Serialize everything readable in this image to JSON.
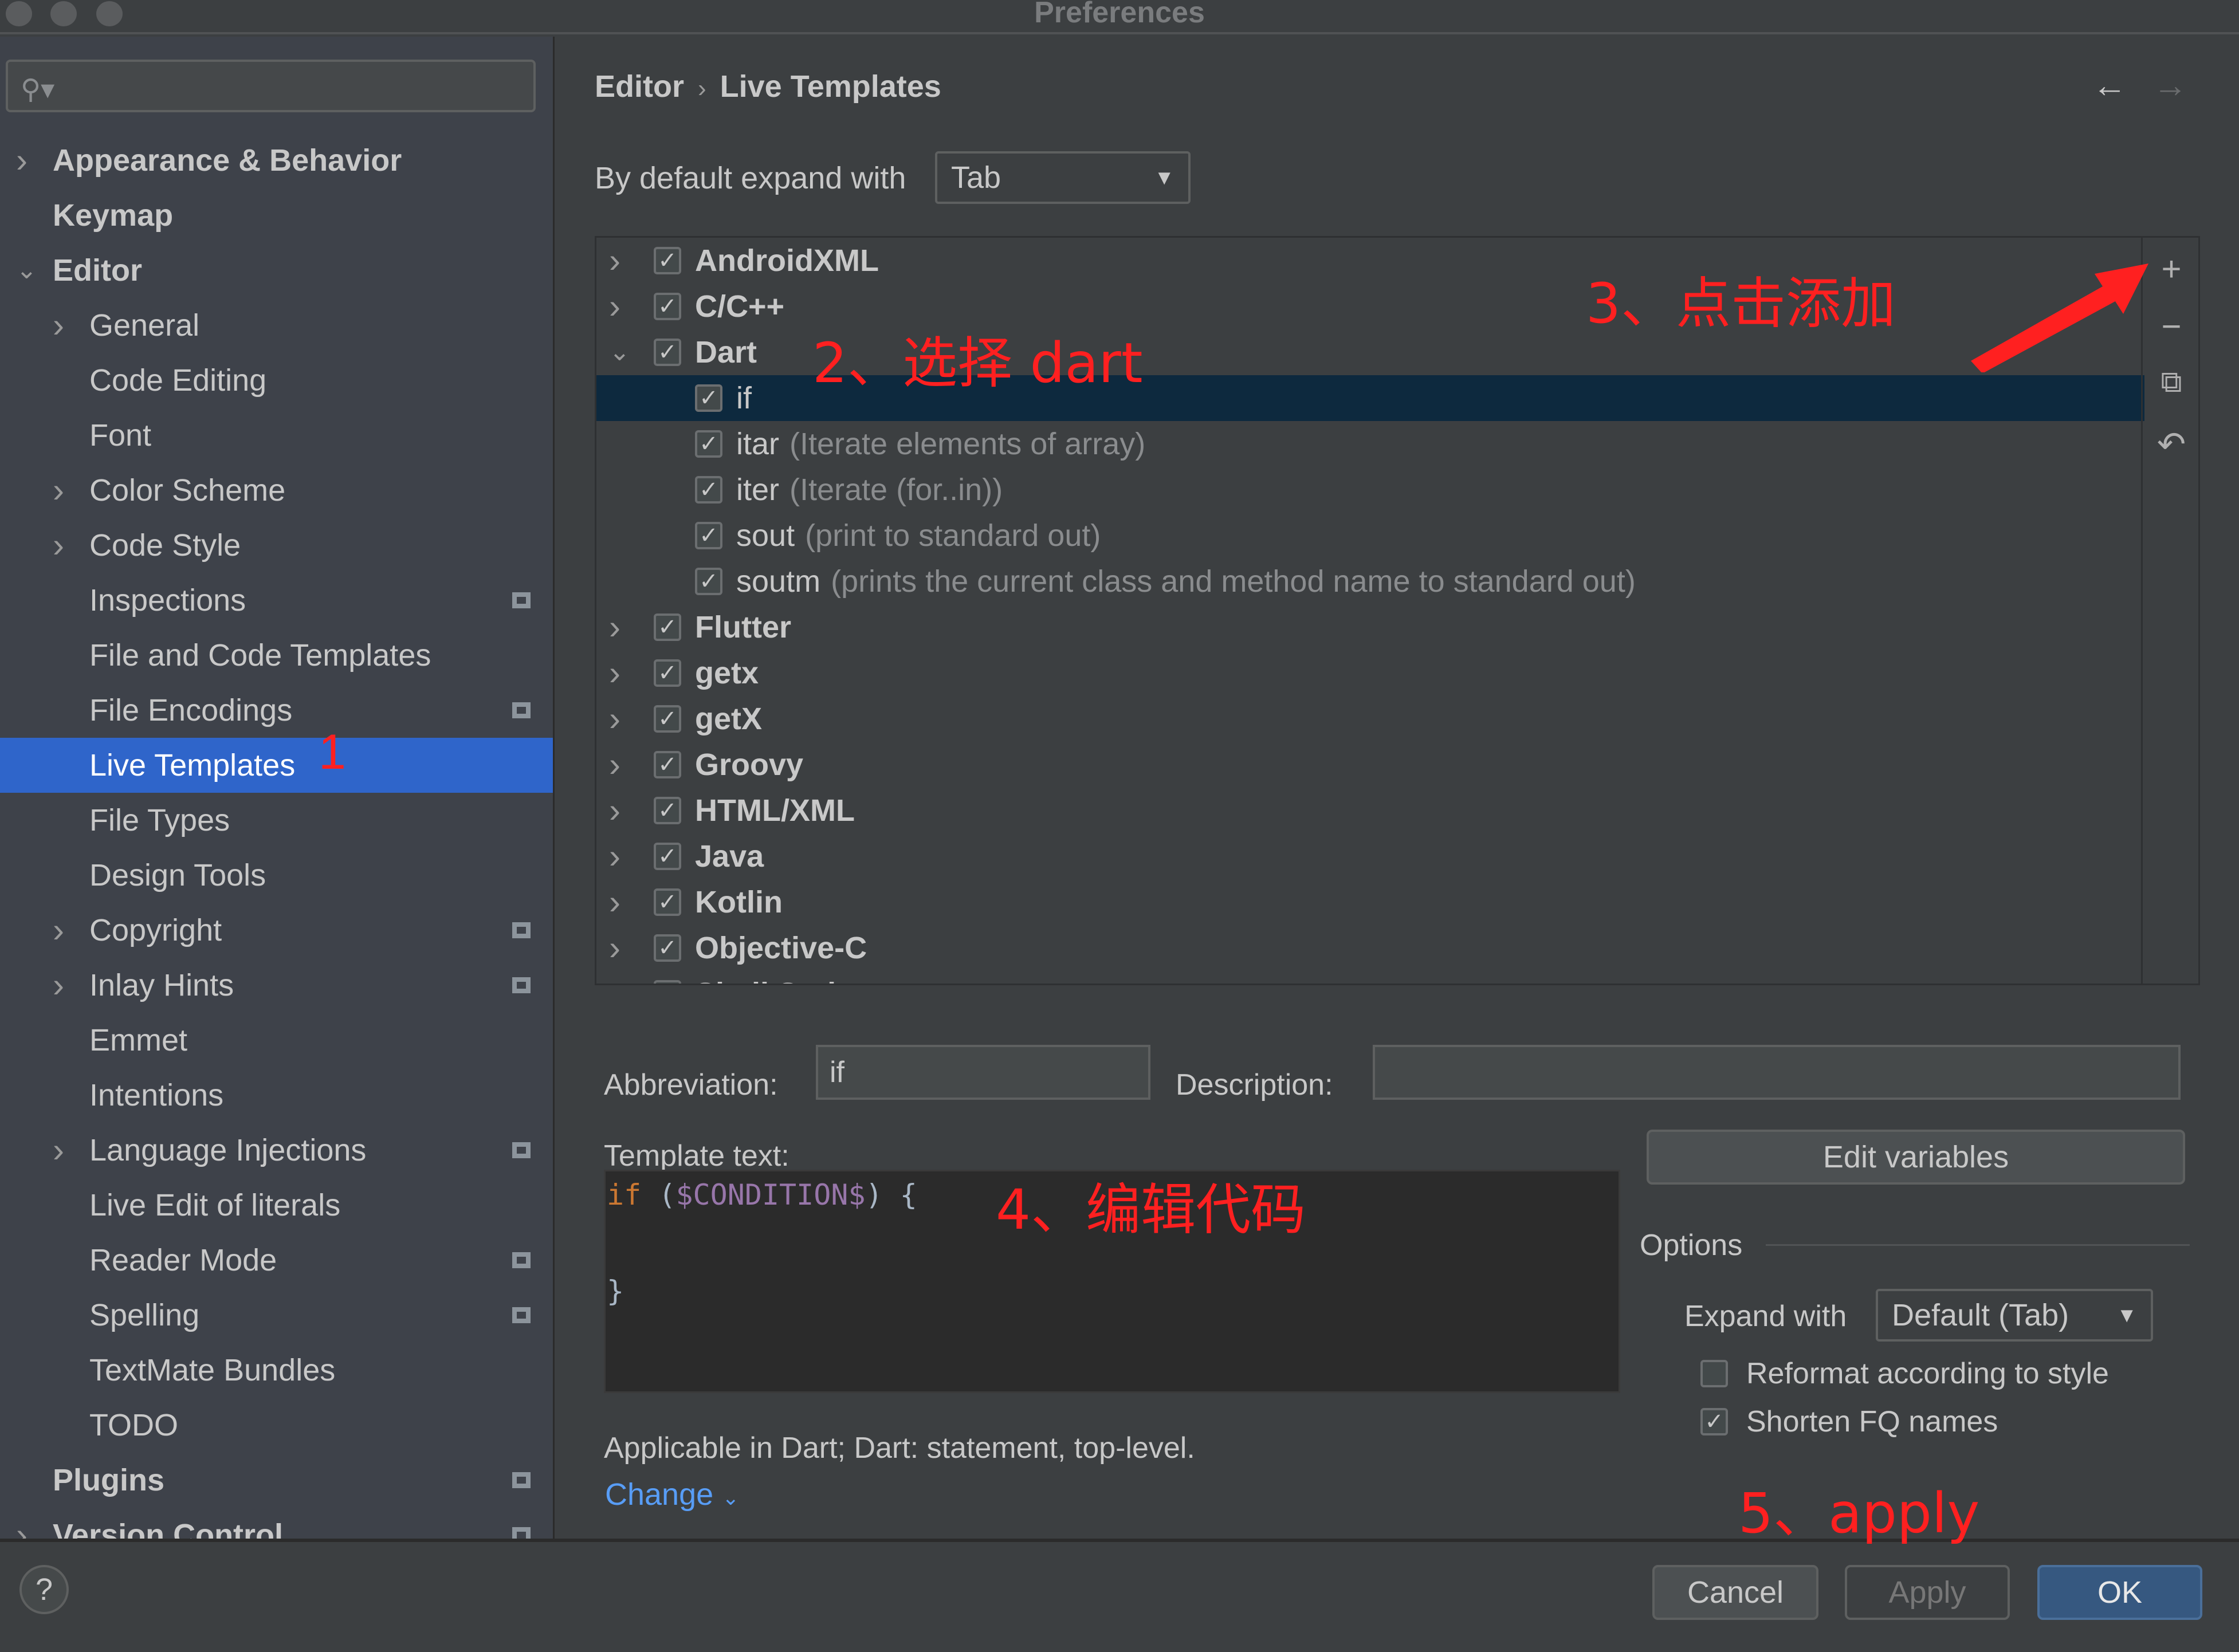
{
  "window": {
    "title": "Preferences"
  },
  "search": {
    "placeholder": ""
  },
  "sidebar": {
    "items": [
      {
        "label": "Appearance & Behavior",
        "level": 0,
        "chevron": "right"
      },
      {
        "label": "Keymap",
        "level": 0,
        "chevron": ""
      },
      {
        "label": "Editor",
        "level": 0,
        "chevron": "down"
      },
      {
        "label": "General",
        "level": 1,
        "chevron": "right"
      },
      {
        "label": "Code Editing",
        "level": 1,
        "chevron": ""
      },
      {
        "label": "Font",
        "level": 1,
        "chevron": ""
      },
      {
        "label": "Color Scheme",
        "level": 1,
        "chevron": "right"
      },
      {
        "label": "Code Style",
        "level": 1,
        "chevron": "right"
      },
      {
        "label": "Inspections",
        "level": 1,
        "chevron": "",
        "badge": true
      },
      {
        "label": "File and Code Templates",
        "level": 1,
        "chevron": ""
      },
      {
        "label": "File Encodings",
        "level": 1,
        "chevron": "",
        "badge": true
      },
      {
        "label": "Live Templates",
        "level": 1,
        "chevron": "",
        "selected": true
      },
      {
        "label": "File Types",
        "level": 1,
        "chevron": ""
      },
      {
        "label": "Design Tools",
        "level": 1,
        "chevron": ""
      },
      {
        "label": "Copyright",
        "level": 1,
        "chevron": "right",
        "badge": true
      },
      {
        "label": "Inlay Hints",
        "level": 1,
        "chevron": "right",
        "badge": true
      },
      {
        "label": "Emmet",
        "level": 1,
        "chevron": ""
      },
      {
        "label": "Intentions",
        "level": 1,
        "chevron": ""
      },
      {
        "label": "Language Injections",
        "level": 1,
        "chevron": "right",
        "badge": true
      },
      {
        "label": "Live Edit of literals",
        "level": 1,
        "chevron": ""
      },
      {
        "label": "Reader Mode",
        "level": 1,
        "chevron": "",
        "badge": true
      },
      {
        "label": "Spelling",
        "level": 1,
        "chevron": "",
        "badge": true
      },
      {
        "label": "TextMate Bundles",
        "level": 1,
        "chevron": ""
      },
      {
        "label": "TODO",
        "level": 1,
        "chevron": ""
      },
      {
        "label": "Plugins",
        "level": 0,
        "chevron": "",
        "badge": true
      },
      {
        "label": "Version Control",
        "level": 0,
        "chevron": "right",
        "badge": true
      }
    ]
  },
  "breadcrumb": {
    "parent": "Editor",
    "separator": "›",
    "current": "Live Templates",
    "back_icon": "←",
    "forward_icon": "→"
  },
  "expand_default": {
    "label": "By default expand with",
    "value": "Tab"
  },
  "tree": {
    "rows": [
      {
        "name": "AndroidXML",
        "desc": "",
        "group": true,
        "expanded": false,
        "checked": true
      },
      {
        "name": "C/C++",
        "desc": "",
        "group": true,
        "expanded": false,
        "checked": true
      },
      {
        "name": "Dart",
        "desc": "",
        "group": true,
        "expanded": true,
        "checked": true
      },
      {
        "name": "if",
        "desc": "",
        "group": false,
        "checked": true,
        "selected": true
      },
      {
        "name": "itar",
        "desc": "(Iterate elements of array)",
        "group": false,
        "checked": true
      },
      {
        "name": "iter",
        "desc": "(Iterate (for..in))",
        "group": false,
        "checked": true
      },
      {
        "name": "sout",
        "desc": "(print to standard out)",
        "group": false,
        "checked": true
      },
      {
        "name": "soutm",
        "desc": "(prints the current class and method name to standard out)",
        "group": false,
        "checked": true
      },
      {
        "name": "Flutter",
        "desc": "",
        "group": true,
        "expanded": false,
        "checked": true
      },
      {
        "name": "getx",
        "desc": "",
        "group": true,
        "expanded": false,
        "checked": true
      },
      {
        "name": "getX",
        "desc": "",
        "group": true,
        "expanded": false,
        "checked": true
      },
      {
        "name": "Groovy",
        "desc": "",
        "group": true,
        "expanded": false,
        "checked": true
      },
      {
        "name": "HTML/XML",
        "desc": "",
        "group": true,
        "expanded": false,
        "checked": true
      },
      {
        "name": "Java",
        "desc": "",
        "group": true,
        "expanded": false,
        "checked": true
      },
      {
        "name": "Kotlin",
        "desc": "",
        "group": true,
        "expanded": false,
        "checked": true
      },
      {
        "name": "Objective-C",
        "desc": "",
        "group": true,
        "expanded": false,
        "checked": true
      },
      {
        "name": "Shell Script",
        "desc": "",
        "group": true,
        "expanded": false,
        "checked": true
      }
    ],
    "tools": {
      "add": "+",
      "remove": "−",
      "copy": "⧉",
      "restore": "↶"
    }
  },
  "form": {
    "abbreviation_label": "Abbreviation:",
    "abbreviation_value": "if",
    "description_label": "Description:",
    "description_value": "",
    "template_text_label": "Template text:",
    "code": {
      "kw": "if",
      "open": " (",
      "var": "$CONDITION$",
      "close": ") {",
      "end": "}"
    },
    "edit_variables": "Edit variables",
    "options_label": "Options",
    "expand_with_label": "Expand with",
    "expand_with_value": "Default (Tab)",
    "reformat_label": "Reformat according to style",
    "reformat_checked": false,
    "shorten_label": "Shorten FQ names",
    "shorten_checked": true,
    "applicable": "Applicable in Dart; Dart: statement, top-level.",
    "change_link": "Change"
  },
  "footer": {
    "help": "?",
    "cancel": "Cancel",
    "apply": "Apply",
    "ok": "OK"
  },
  "annotations": {
    "step1": "1",
    "step2": "2、选择 dart",
    "step3": "3、点击添加",
    "step4": "4、编辑代码",
    "step5": "5、apply",
    "color": "#ff2020"
  },
  "colors": {
    "selection": "#2f65ca",
    "tree_selection": "#0d293e",
    "link": "#589df6",
    "primary_button": "#365880"
  }
}
